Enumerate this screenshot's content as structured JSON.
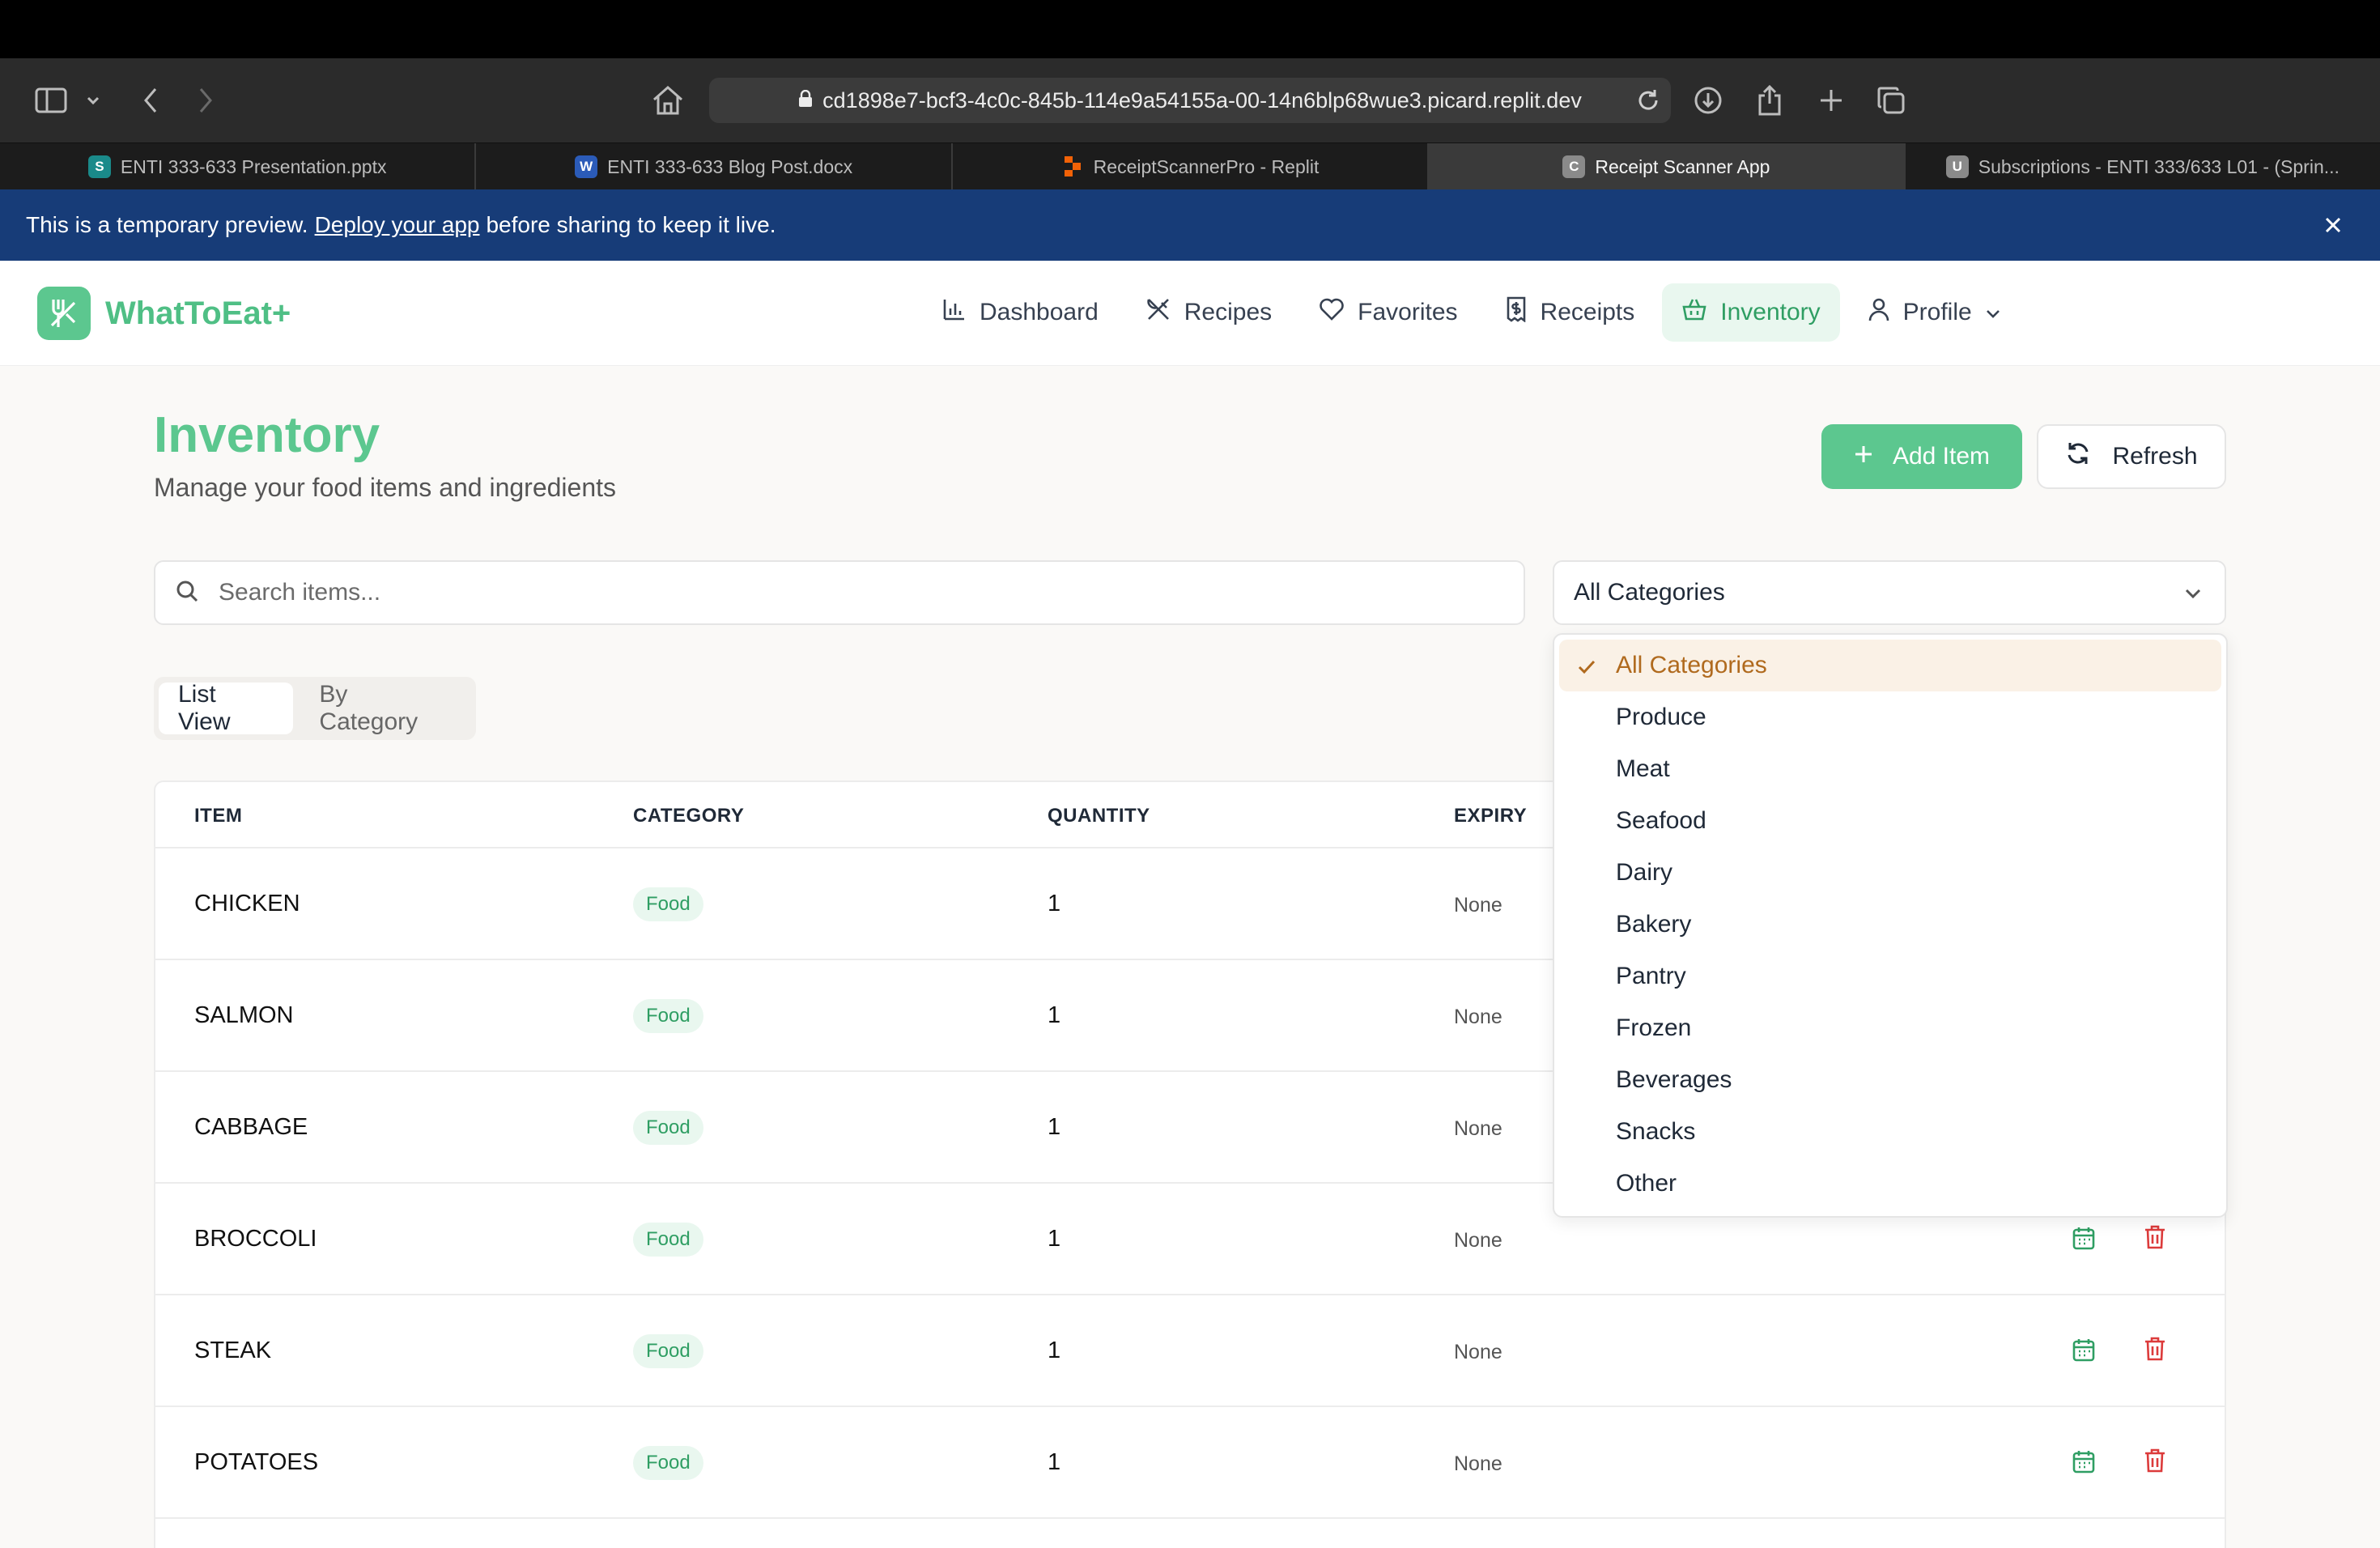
{
  "browser": {
    "url": "cd1898e7-bcf3-4c0c-845b-114e9a54155a-00-14n6blp68wue3.picard.replit.dev",
    "tabs": [
      {
        "label": "ENTI 333-633 Presentation.pptx",
        "favicon": "S",
        "favicon_color": "#1a8a8a"
      },
      {
        "label": "ENTI 333-633 Blog Post.docx",
        "favicon": "W",
        "favicon_color": "#2b5bb8"
      },
      {
        "label": "ReceiptScannerPro - Replit",
        "favicon": "R",
        "favicon_color": "#f26207"
      },
      {
        "label": "Receipt Scanner App",
        "favicon": "C",
        "favicon_color": "#8a8a8a"
      },
      {
        "label": "Subscriptions - ENTI 333/633 L01 - (Sprin...",
        "favicon": "U",
        "favicon_color": "#8a8a8a"
      }
    ]
  },
  "banner": {
    "text_before": "This is a temporary preview.",
    "link": "Deploy your app",
    "text_after": "before sharing to keep it live."
  },
  "header": {
    "app_name": "WhatToEat+",
    "nav": [
      {
        "label": "Dashboard",
        "icon": "bar-chart-icon"
      },
      {
        "label": "Recipes",
        "icon": "utensils-icon"
      },
      {
        "label": "Favorites",
        "icon": "heart-icon"
      },
      {
        "label": "Receipts",
        "icon": "receipt-icon"
      },
      {
        "label": "Inventory",
        "icon": "basket-icon",
        "active": true
      },
      {
        "label": "Profile",
        "icon": "user-icon"
      }
    ]
  },
  "page": {
    "title": "Inventory",
    "subtitle": "Manage your food items and ingredients",
    "add_button": "Add Item",
    "refresh_button": "Refresh"
  },
  "filters": {
    "search_placeholder": "Search items...",
    "category_selected": "All Categories",
    "category_options": [
      "All Categories",
      "Produce",
      "Meat",
      "Seafood",
      "Dairy",
      "Bakery",
      "Pantry",
      "Frozen",
      "Beverages",
      "Snacks",
      "Other"
    ]
  },
  "view_toggle": [
    "List View",
    "By Category"
  ],
  "table": {
    "headers": [
      "ITEM",
      "CATEGORY",
      "QUANTITY",
      "EXPIRY"
    ],
    "rows": [
      {
        "item": "CHICKEN",
        "category": "Food",
        "quantity": "1",
        "expiry": "None"
      },
      {
        "item": "SALMON",
        "category": "Food",
        "quantity": "1",
        "expiry": "None"
      },
      {
        "item": "CABBAGE",
        "category": "Food",
        "quantity": "1",
        "expiry": "None"
      },
      {
        "item": "BROCCOLI",
        "category": "Food",
        "quantity": "1",
        "expiry": "None"
      },
      {
        "item": "STEAK",
        "category": "Food",
        "quantity": "1",
        "expiry": "None"
      },
      {
        "item": "POTATOES",
        "category": "Food",
        "quantity": "1",
        "expiry": "None"
      }
    ]
  },
  "colors": {
    "brand_green": "#5cc78f",
    "banner_blue": "#173c78",
    "selected_option": "#b06a1e",
    "delete_red": "#dc3b3b"
  }
}
